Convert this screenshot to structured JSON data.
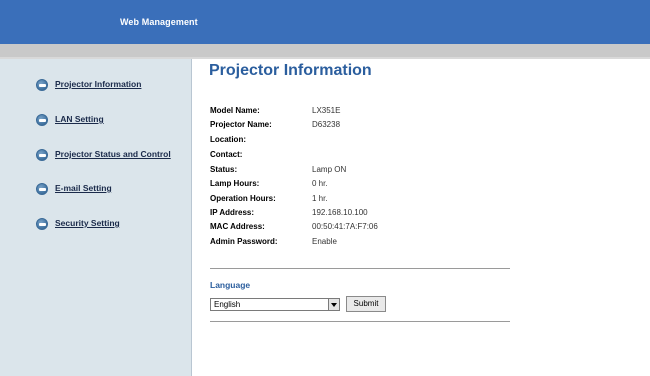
{
  "header": {
    "title": "Web Management"
  },
  "sidebar": {
    "items": [
      {
        "label": "Projector Information",
        "icon": "arrow-circle-icon"
      },
      {
        "label": "LAN Setting",
        "icon": "arrow-circle-icon"
      },
      {
        "label": "Projector Status and Control",
        "icon": "arrow-circle-icon"
      },
      {
        "label": "E-mail Setting",
        "icon": "arrow-circle-icon"
      },
      {
        "label": "Security Setting",
        "icon": "arrow-circle-icon"
      }
    ]
  },
  "main": {
    "title": "Projector Information",
    "info": [
      {
        "label": "Model Name:",
        "value": "LX351E"
      },
      {
        "label": "Projector Name:",
        "value": "D63238"
      },
      {
        "label": "Location:",
        "value": ""
      },
      {
        "label": "Contact:",
        "value": ""
      },
      {
        "label": "Status:",
        "value": "Lamp ON"
      },
      {
        "label": "Lamp Hours:",
        "value": "0 hr."
      },
      {
        "label": "Operation Hours:",
        "value": "1 hr."
      },
      {
        "label": "IP Address:",
        "value": "192.168.10.100"
      },
      {
        "label": "MAC Address:",
        "value": "00:50:41:7A:F7:06"
      },
      {
        "label": "Admin Password:",
        "value": "Enable"
      }
    ],
    "language": {
      "title": "Language",
      "selected": "English",
      "submit_label": "Submit"
    }
  },
  "colors": {
    "header_bg": "#3a6fba",
    "sidebar_bg": "#dbe5eb",
    "accent": "#2b5e9e"
  }
}
